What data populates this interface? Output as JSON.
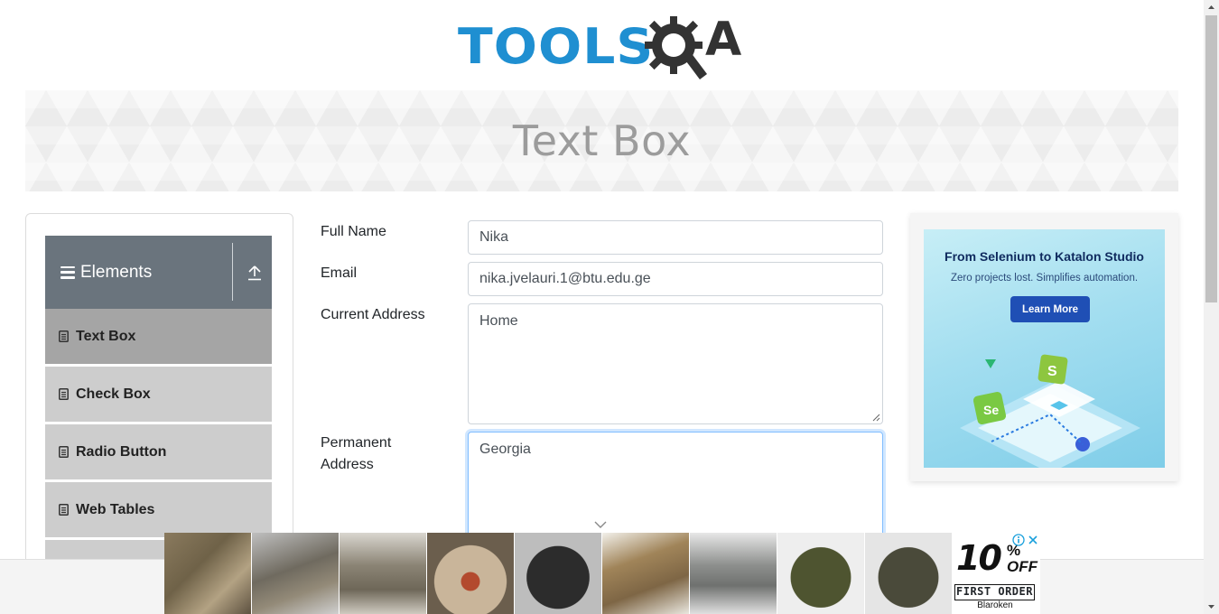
{
  "header": {
    "logo_text": "TOOLS",
    "logo_suffix": "A"
  },
  "banner": {
    "title": "Text Box"
  },
  "sidebar": {
    "group_title": "Elements",
    "items": [
      {
        "label": "Text Box",
        "active": true
      },
      {
        "label": "Check Box",
        "active": false
      },
      {
        "label": "Radio Button",
        "active": false
      },
      {
        "label": "Web Tables",
        "active": false
      }
    ]
  },
  "form": {
    "full_name": {
      "label": "Full Name",
      "value": "Nika"
    },
    "email": {
      "label": "Email",
      "value": "nika.jvelauri.1@btu.edu.ge"
    },
    "current_address": {
      "label": "Current Address",
      "value": "Home"
    },
    "permanent_address": {
      "label_line1": "Permanent",
      "label_line2": "Address",
      "value": "Georgia"
    }
  },
  "side_ad": {
    "title": "From Selenium to Katalon Studio",
    "subtitle": "Zero projects lost. Simplifies automation.",
    "button": "Learn More"
  },
  "bottom_ad": {
    "discount": "10",
    "percent": "%",
    "off": "OFF",
    "first_order": "FIRST ORDER",
    "brand": "Blaroken"
  },
  "colors": {
    "accent": "#1f8fd1",
    "sidebar_header": "#6a747d",
    "menu_item": "#cdcdcd",
    "menu_item_active": "#a5a5a5"
  }
}
